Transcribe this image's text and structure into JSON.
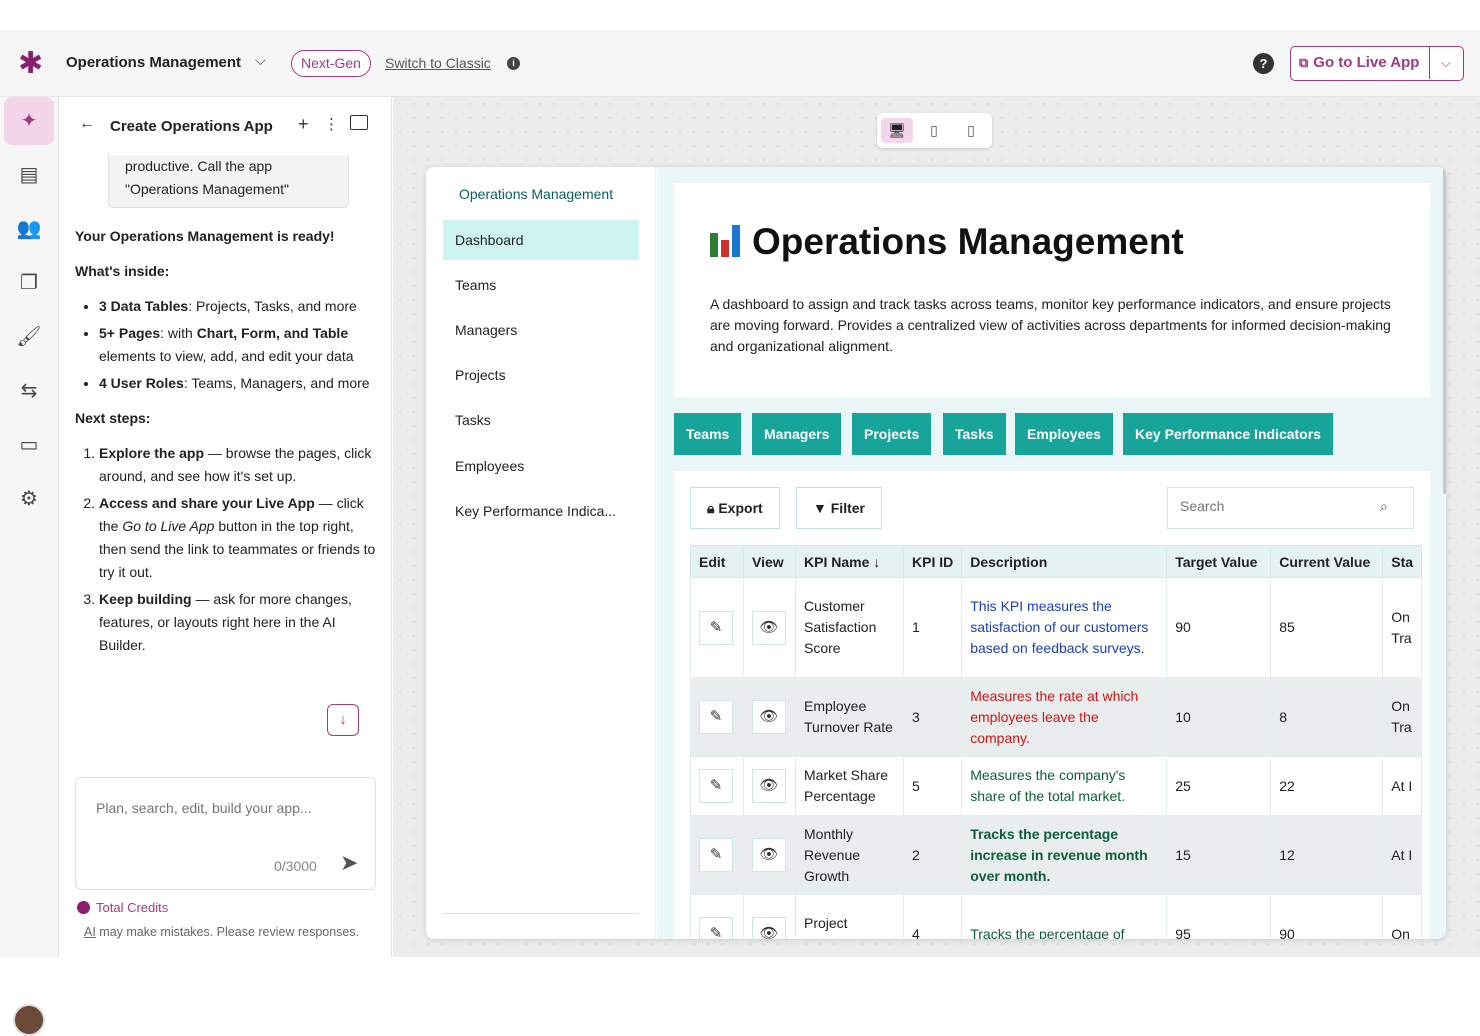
{
  "header": {
    "app_name": "Operations Management",
    "badge": "Next-Gen",
    "switch_link": "Switch to Classic",
    "go_live": "Go to Live App",
    "help": "?"
  },
  "chat": {
    "title": "Create Operations App",
    "bubble": "productive. Call the app \"Operations Management\"",
    "ready": "Your Operations Management is ready!",
    "whats_inside": "What's inside:",
    "inside": [
      {
        "bold": "3 Data Tables",
        "text": ": Projects, Tasks, and more"
      },
      {
        "bold": "5+ Pages",
        "text": ": with ",
        "bold2": "Chart, Form, and Table",
        "text2": " elements to view, add, and edit your data"
      },
      {
        "bold": "4 User Roles",
        "text": ": Teams, Managers, and more"
      }
    ],
    "next_steps": "Next steps:",
    "steps": [
      {
        "bold": "Explore the app",
        "text": " — browse the pages, click around, and see how it's set up."
      },
      {
        "bold": "Access and share your Live App",
        "text": " — click the ",
        "italic": "Go to Live App",
        "text2": " button in the top right, then send the link to teammates or friends to try it out."
      },
      {
        "bold": "Keep building",
        "text": " — ask for more changes, features, or layouts right here in the AI Builder."
      }
    ],
    "placeholder": "Plan, search, edit, build your app...",
    "counter": "0/3000",
    "credits": "Total Credits",
    "disclaimer_ai": "AI",
    "disclaimer": " may make mistakes. Please review responses."
  },
  "preview": {
    "nav_title": "Operations Management",
    "nav_items": [
      "Dashboard",
      "Teams",
      "Managers",
      "Projects",
      "Tasks",
      "Employees",
      "Key Performance Indica..."
    ],
    "hero_title": "Operations Management",
    "hero_desc": "A dashboard to assign and track tasks across teams, monitor key performance indicators, and ensure projects are moving forward. Provides a centralized view of activities across departments for informed decision-making and organizational alignment.",
    "tabs": [
      "Teams",
      "Managers",
      "Projects",
      "Tasks",
      "Employees",
      "Key Performance Indicators"
    ],
    "export": "Export",
    "filter": "Filter",
    "search_placeholder": "Search",
    "columns": [
      "Edit",
      "View",
      "KPI Name",
      "KPI ID",
      "Description",
      "Target Value",
      "Current Value",
      "Sta"
    ],
    "rows": [
      {
        "name": "Customer Satisfaction Score",
        "id": "1",
        "desc": "This KPI measures the satisfaction of our customers based on feedback surveys.",
        "target": "90",
        "current": "85",
        "status": "On Tra"
      },
      {
        "name": "Employee Turnover Rate",
        "id": "3",
        "desc": "Measures the rate at which employees leave the company.",
        "target": "10",
        "current": "8",
        "status": "On Tra"
      },
      {
        "name": "Market Share Percentage",
        "id": "5",
        "desc": "Measures the company's share of the total market.",
        "target": "25",
        "current": "22",
        "status": "At I"
      },
      {
        "name": "Monthly Revenue Growth",
        "id": "2",
        "desc": "Tracks the percentage increase in revenue month over month.",
        "target": "15",
        "current": "12",
        "status": "At I"
      },
      {
        "name": "Project Delivery",
        "id": "4",
        "desc": "Tracks the percentage of",
        "target": "95",
        "current": "90",
        "status": "On"
      }
    ]
  },
  "colors": {
    "brand": "#a13a7e",
    "teal": "#17a59b",
    "nav_active": "#cdf3f3"
  }
}
